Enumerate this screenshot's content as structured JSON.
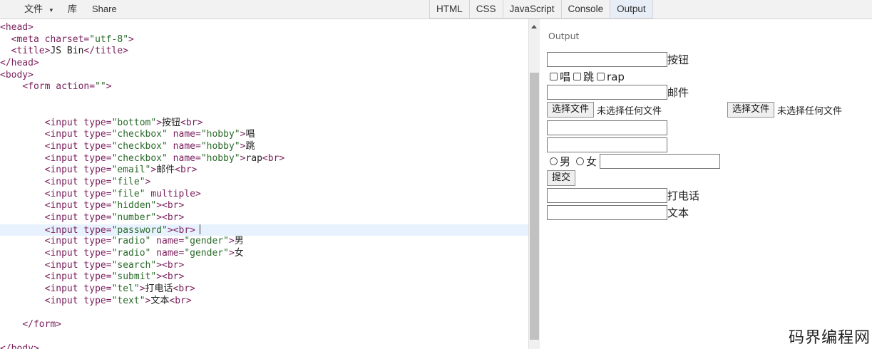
{
  "menu": {
    "file": "文件",
    "file_caret": "▾",
    "library": "库",
    "share": "Share"
  },
  "tabs": [
    "HTML",
    "CSS",
    "JavaScript",
    "Console",
    "Output"
  ],
  "code_lines": [
    [
      [
        "tag",
        "<head>"
      ]
    ],
    [
      [
        "txt",
        "  "
      ],
      [
        "tag",
        "<meta "
      ],
      [
        "attr",
        "charset="
      ],
      [
        "str",
        "\"utf-8\""
      ],
      [
        "tag",
        ">"
      ]
    ],
    [
      [
        "txt",
        "  "
      ],
      [
        "tag",
        "<title>"
      ],
      [
        "txt",
        "JS Bin"
      ],
      [
        "tag",
        "</title>"
      ]
    ],
    [
      [
        "tag",
        "</head>"
      ]
    ],
    [
      [
        "tag",
        "<body>"
      ]
    ],
    [
      [
        "txt",
        "    "
      ],
      [
        "tag",
        "<form "
      ],
      [
        "attr",
        "action="
      ],
      [
        "str",
        "\"\""
      ],
      [
        "tag",
        ">"
      ]
    ],
    [],
    [],
    [
      [
        "txt",
        "        "
      ],
      [
        "tag",
        "<input "
      ],
      [
        "attr",
        "type="
      ],
      [
        "str",
        "\"bottom\""
      ],
      [
        "tag",
        ">"
      ],
      [
        "txt",
        "按钮"
      ],
      [
        "tag",
        "<br>"
      ]
    ],
    [
      [
        "txt",
        "        "
      ],
      [
        "tag",
        "<input "
      ],
      [
        "attr",
        "type="
      ],
      [
        "str",
        "\"checkbox\""
      ],
      [
        "attr",
        " name="
      ],
      [
        "str",
        "\"hobby\""
      ],
      [
        "tag",
        ">"
      ],
      [
        "txt",
        "唱"
      ]
    ],
    [
      [
        "txt",
        "        "
      ],
      [
        "tag",
        "<input "
      ],
      [
        "attr",
        "type="
      ],
      [
        "str",
        "\"checkbox\""
      ],
      [
        "attr",
        " name="
      ],
      [
        "str",
        "\"hobby\""
      ],
      [
        "tag",
        ">"
      ],
      [
        "txt",
        "跳"
      ]
    ],
    [
      [
        "txt",
        "        "
      ],
      [
        "tag",
        "<input "
      ],
      [
        "attr",
        "type="
      ],
      [
        "str",
        "\"checkbox\""
      ],
      [
        "attr",
        " name="
      ],
      [
        "str",
        "\"hobby\""
      ],
      [
        "tag",
        ">"
      ],
      [
        "txt",
        "rap"
      ],
      [
        "tag",
        "<br>"
      ]
    ],
    [
      [
        "txt",
        "        "
      ],
      [
        "tag",
        "<input "
      ],
      [
        "attr",
        "type="
      ],
      [
        "str",
        "\"email\""
      ],
      [
        "tag",
        ">"
      ],
      [
        "txt",
        "邮件"
      ],
      [
        "tag",
        "<br>"
      ]
    ],
    [
      [
        "txt",
        "        "
      ],
      [
        "tag",
        "<input "
      ],
      [
        "attr",
        "type="
      ],
      [
        "str",
        "\"file\""
      ],
      [
        "tag",
        ">"
      ]
    ],
    [
      [
        "txt",
        "        "
      ],
      [
        "tag",
        "<input "
      ],
      [
        "attr",
        "type="
      ],
      [
        "str",
        "\"file\""
      ],
      [
        "attr",
        " multiple"
      ],
      [
        "tag",
        ">"
      ]
    ],
    [
      [
        "txt",
        "        "
      ],
      [
        "tag",
        "<input "
      ],
      [
        "attr",
        "type="
      ],
      [
        "str",
        "\"hidden\""
      ],
      [
        "tag",
        ">"
      ],
      [
        "tag",
        "<br>"
      ]
    ],
    [
      [
        "txt",
        "        "
      ],
      [
        "tag",
        "<input "
      ],
      [
        "attr",
        "type="
      ],
      [
        "str",
        "\"number\""
      ],
      [
        "tag",
        ">"
      ],
      [
        "tag",
        "<br>"
      ]
    ],
    [
      [
        "txt",
        "        "
      ],
      [
        "tag",
        "<input "
      ],
      [
        "attr",
        "type="
      ],
      [
        "str",
        "\"password\""
      ],
      [
        "tag",
        ">"
      ],
      [
        "tag",
        "<br>"
      ]
    ],
    [
      [
        "txt",
        "        "
      ],
      [
        "tag",
        "<input "
      ],
      [
        "attr",
        "type="
      ],
      [
        "str",
        "\"radio\""
      ],
      [
        "attr",
        " name="
      ],
      [
        "str",
        "\"gender\""
      ],
      [
        "tag",
        ">"
      ],
      [
        "txt",
        "男"
      ]
    ],
    [
      [
        "txt",
        "        "
      ],
      [
        "tag",
        "<input "
      ],
      [
        "attr",
        "type="
      ],
      [
        "str",
        "\"radio\""
      ],
      [
        "attr",
        " name="
      ],
      [
        "str",
        "\"gender\""
      ],
      [
        "tag",
        ">"
      ],
      [
        "txt",
        "女"
      ]
    ],
    [
      [
        "txt",
        "        "
      ],
      [
        "tag",
        "<input "
      ],
      [
        "attr",
        "type="
      ],
      [
        "str",
        "\"search\""
      ],
      [
        "tag",
        ">"
      ],
      [
        "tag",
        "<br>"
      ]
    ],
    [
      [
        "txt",
        "        "
      ],
      [
        "tag",
        "<input "
      ],
      [
        "attr",
        "type="
      ],
      [
        "str",
        "\"submit\""
      ],
      [
        "tag",
        ">"
      ],
      [
        "tag",
        "<br>"
      ]
    ],
    [
      [
        "txt",
        "        "
      ],
      [
        "tag",
        "<input "
      ],
      [
        "attr",
        "type="
      ],
      [
        "str",
        "\"tel\""
      ],
      [
        "tag",
        ">"
      ],
      [
        "txt",
        "打电话"
      ],
      [
        "tag",
        "<br>"
      ]
    ],
    [
      [
        "txt",
        "        "
      ],
      [
        "tag",
        "<input "
      ],
      [
        "attr",
        "type="
      ],
      [
        "str",
        "\"text\""
      ],
      [
        "tag",
        ">"
      ],
      [
        "txt",
        "文本"
      ],
      [
        "tag",
        "<br>"
      ]
    ],
    [],
    [
      [
        "txt",
        "    "
      ],
      [
        "tag",
        "</form>"
      ]
    ],
    [],
    [
      [
        "tag",
        "</body>"
      ]
    ]
  ],
  "output": {
    "label": "Output",
    "button_text_label": "按钮",
    "checkbox_sing": "唱",
    "checkbox_jump": "跳",
    "checkbox_rap": "rap",
    "email_label": "邮件",
    "file_button": "选择文件",
    "file_none": "未选择任何文件",
    "file_multi_button": "选择文件",
    "file_multi_none": "未选择任何文件",
    "radio_male": "男",
    "radio_female": "女",
    "submit": "提交",
    "tel_label": "打电话",
    "text_label": "文本"
  },
  "watermark": "码界编程网"
}
